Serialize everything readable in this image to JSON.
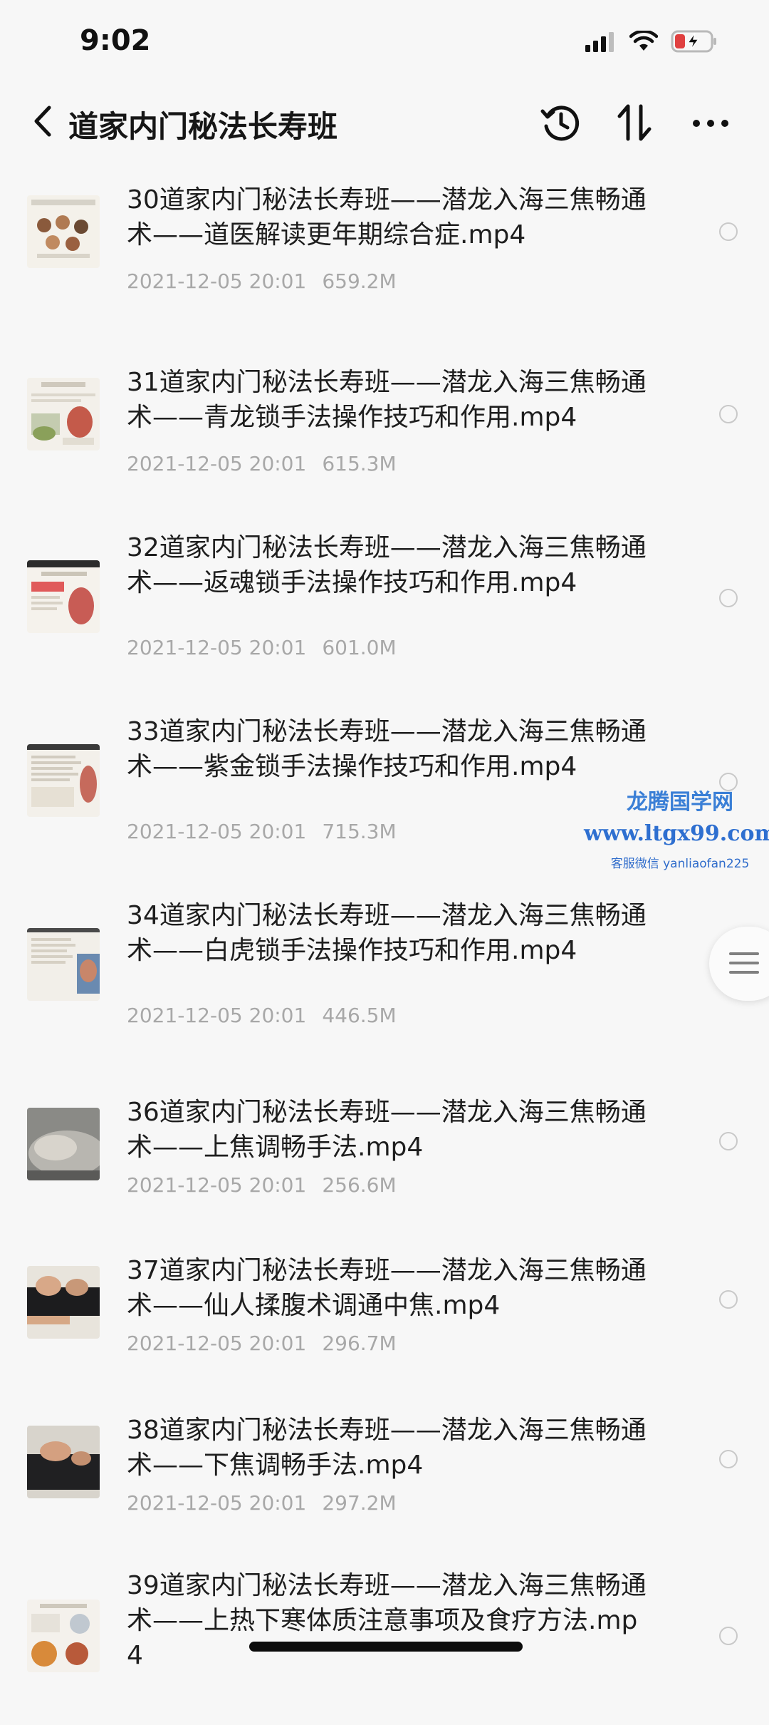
{
  "status_bar": {
    "time": "9:02"
  },
  "header": {
    "title": "道家内门秘法长寿班"
  },
  "files": [
    {
      "name": "30道家内门秘法长寿班——潜龙入海三焦畅通术——道医解读更年期综合症.mp4",
      "date": "2021-12-05 20:01",
      "size": "659.2M",
      "thumbnail": "document-thumbnail"
    },
    {
      "name": "31道家内门秘法长寿班——潜龙入海三焦畅通术——青龙锁手法操作技巧和作用.mp4",
      "date": "2021-12-05 20:01",
      "size": "615.3M",
      "thumbnail": "document-thumbnail"
    },
    {
      "name": "32道家内门秘法长寿班——潜龙入海三焦畅通术——返魂锁手法操作技巧和作用.mp4",
      "date": "2021-12-05 20:01",
      "size": "601.0M",
      "thumbnail": "document-thumbnail"
    },
    {
      "name": "33道家内门秘法长寿班——潜龙入海三焦畅通术——紫金锁手法操作技巧和作用.mp4",
      "date": "2021-12-05 20:01",
      "size": "715.3M",
      "thumbnail": "document-thumbnail"
    },
    {
      "name": "34道家内门秘法长寿班——潜龙入海三焦畅通术——白虎锁手法操作技巧和作用.mp4",
      "date": "2021-12-05 20:01",
      "size": "446.5M",
      "thumbnail": "document-thumbnail"
    },
    {
      "name": "36道家内门秘法长寿班——潜龙入海三焦畅通术——上焦调畅手法.mp4",
      "date": "2021-12-05 20:01",
      "size": "256.6M",
      "thumbnail": "video-thumbnail"
    },
    {
      "name": "37道家内门秘法长寿班——潜龙入海三焦畅通术——仙人揉腹术调通中焦.mp4",
      "date": "2021-12-05 20:01",
      "size": "296.7M",
      "thumbnail": "video-thumbnail"
    },
    {
      "name": "38道家内门秘法长寿班——潜龙入海三焦畅通术——下焦调畅手法.mp4",
      "date": "2021-12-05 20:01",
      "size": "297.2M",
      "thumbnail": "video-thumbnail"
    },
    {
      "name": "39道家内门秘法长寿班——潜龙入海三焦畅通术——上热下寒体质注意事项及食疗方法.mp4",
      "date": "",
      "size": "",
      "thumbnail": "document-thumbnail"
    }
  ],
  "watermark": {
    "title": "龙腾国学网",
    "url": "www.ltgx99.com",
    "wechat": "客服微信 yanliaofan225"
  },
  "icons": {
    "back": "chevron-left-icon",
    "history": "history-icon",
    "sort": "sort-icon",
    "more": "more-icon",
    "side_menu": "menu-icon"
  }
}
